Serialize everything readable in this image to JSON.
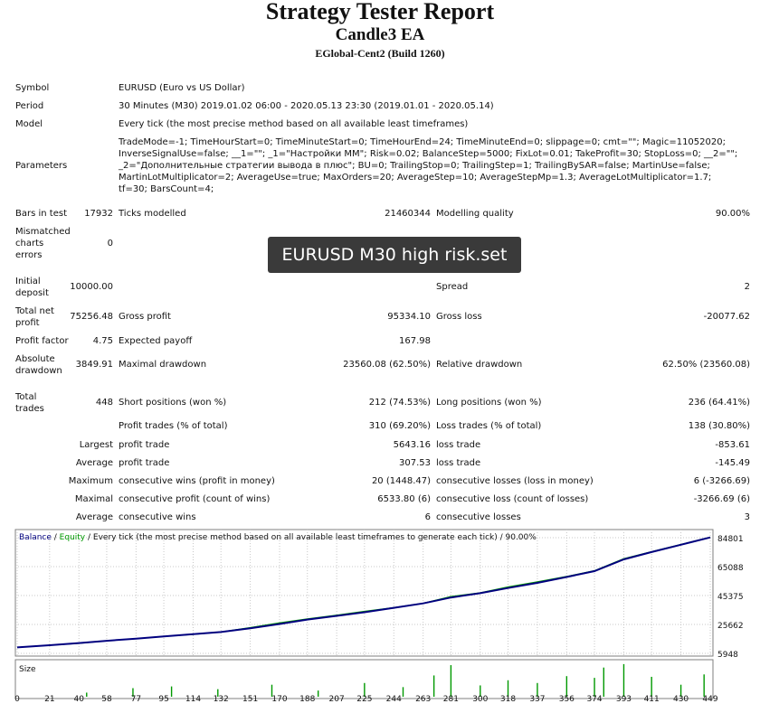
{
  "report": {
    "title": "Strategy Tester Report",
    "ea_name": "Candle3 EA",
    "server": "EGlobal-Cent2 (Build 1260)"
  },
  "settings": {
    "symbol_label": "Symbol",
    "symbol_value": "EURUSD (Euro vs US Dollar)",
    "period_label": "Period",
    "period_value": "30 Minutes (M30) 2019.01.02 06:00 - 2020.05.13 23:30 (2019.01.01 - 2020.05.14)",
    "model_label": "Model",
    "model_value": "Every tick (the most precise method based on all available least timeframes)",
    "parameters_label": "Parameters",
    "parameters_value": "TradeMode=-1; TimeHourStart=0; TimeMinuteStart=0; TimeHourEnd=24; TimeMinuteEnd=0; slippage=0; cmt=\"\"; Magic=11052020; InverseSignalUse=false; __1=\"\"; _1=\"Настройки ММ\"; Risk=0.02; BalanceStep=5000; FixLot=0.01; TakeProfit=30; StopLoss=0; __2=\"\"; _2=\"Дополнительные стратегии вывода в плюс\"; BU=0; TrailingStop=0; TrailingStep=1; TrailingBySAR=false; MartinUse=false; MartinLotMultiplicator=2; AverageUse=true; MaxOrders=20; AverageStep=10; AverageStepMp=1.3; AverageLotMultiplicator=1.7; tf=30; BarsCount=4;"
  },
  "test": {
    "bars_label": "Bars in test",
    "bars_value": "17932",
    "ticks_label": "Ticks modelled",
    "ticks_value": "21460344",
    "quality_label": "Modelling quality",
    "quality_value": "90.00%",
    "mismatch_l1": "Mismatched",
    "mismatch_l2": "charts",
    "mismatch_l3": "errors",
    "mismatch_value": "0"
  },
  "overlay_label": "EURUSD M30 high risk.set",
  "results": {
    "deposit_l1": "Initial",
    "deposit_l2": "deposit",
    "deposit_value": "10000.00",
    "spread_label": "Spread",
    "spread_value": "2",
    "net_l1": "Total net",
    "net_l2": "profit",
    "net_value": "75256.48",
    "gross_profit_label": "Gross profit",
    "gross_profit_value": "95334.10",
    "gross_loss_label": "Gross loss",
    "gross_loss_value": "-20077.62",
    "pf_label": "Profit factor",
    "pf_value": "4.75",
    "ep_label": "Expected payoff",
    "ep_value": "167.98",
    "abs_l1": "Absolute",
    "abs_l2": "drawdown",
    "abs_value": "3849.91",
    "max_dd_label": "Maximal drawdown",
    "max_dd_value": "23560.08 (62.50%)",
    "rel_dd_label": "Relative drawdown",
    "rel_dd_value": "62.50% (23560.08)"
  },
  "trades": {
    "total_l1": "Total",
    "total_l2": "trades",
    "total_value": "448",
    "short_label": "Short positions (won %)",
    "short_value": "212 (74.53%)",
    "long_label": "Long positions (won %)",
    "long_value": "236 (64.41%)",
    "pt_label": "Profit trades (% of total)",
    "pt_value": "310 (69.20%)",
    "lt_label": "Loss trades (% of total)",
    "lt_value": "138 (30.80%)",
    "largest_label": "Largest",
    "lpt_label": "profit trade",
    "lpt_value": "5643.16",
    "llt_label": "loss trade",
    "llt_value": "-853.61",
    "average_label": "Average",
    "apt_label": "profit trade",
    "apt_value": "307.53",
    "alt_label": "loss trade",
    "alt_value": "-145.49",
    "maximum_label": "Maximum",
    "mcw_label": "consecutive wins (profit in money)",
    "mcw_value": "20 (1448.47)",
    "mcl_label": "consecutive losses (loss in money)",
    "mcl_value": "6 (-3266.69)",
    "maximal_label": "Maximal",
    "mcp_label": "consecutive profit (count of wins)",
    "mcp_value": "6533.80 (6)",
    "mcloss_label": "consecutive loss (count of losses)",
    "mcloss_value": "-3266.69 (6)",
    "average2_label": "Average",
    "acw_label": "consecutive wins",
    "acw_value": "6",
    "acl_label": "consecutive losses",
    "acl_value": "3"
  },
  "chart_data": {
    "type": "line",
    "legend": {
      "balance": "Balance",
      "sep1": " / ",
      "equity": "Equity",
      "rest": " / Every tick (the most precise method based on all available least timeframes to generate each tick) / 90.00%"
    },
    "size_label": "Size",
    "colors": {
      "balance": "#00007f",
      "equity": "#009900",
      "size": "#009900",
      "grid": "#c8c8c8"
    },
    "y_ticks": [
      "84801",
      "65088",
      "45375",
      "25662",
      "5948"
    ],
    "ylim": [
      5948,
      84801
    ],
    "x_ticks": [
      "0",
      "21",
      "40",
      "58",
      "77",
      "95",
      "114",
      "132",
      "151",
      "170",
      "188",
      "207",
      "225",
      "244",
      "263",
      "281",
      "300",
      "318",
      "337",
      "356",
      "374",
      "393",
      "411",
      "430",
      "449"
    ],
    "xlim": [
      0,
      449
    ],
    "series": [
      {
        "name": "Balance",
        "x": [
          0,
          21,
          40,
          58,
          77,
          95,
          114,
          132,
          151,
          170,
          188,
          207,
          225,
          244,
          263,
          281,
          300,
          318,
          337,
          356,
          374,
          393,
          411,
          430,
          449
        ],
        "y": [
          10000,
          11500,
          13000,
          14500,
          16000,
          17500,
          19000,
          20500,
          23000,
          26000,
          29000,
          31500,
          34000,
          37000,
          40000,
          44000,
          47000,
          50500,
          54000,
          58000,
          62000,
          70000,
          75000,
          80000,
          85000
        ]
      },
      {
        "name": "Equity",
        "x": [
          0,
          21,
          40,
          58,
          77,
          95,
          114,
          132,
          151,
          170,
          188,
          207,
          225,
          244,
          263,
          281,
          300,
          318,
          337,
          356,
          374,
          393,
          411,
          430,
          449
        ],
        "y": [
          10000,
          11500,
          12800,
          14500,
          15900,
          17500,
          18900,
          20500,
          23500,
          26800,
          29500,
          32000,
          34600,
          37200,
          40100,
          44700,
          47200,
          51200,
          54700,
          58400,
          62300,
          70500,
          75300,
          80200,
          85200
        ]
      }
    ],
    "size_bars": [
      {
        "x": 45,
        "v": 0.12
      },
      {
        "x": 75,
        "v": 0.25
      },
      {
        "x": 100,
        "v": 0.3
      },
      {
        "x": 130,
        "v": 0.22
      },
      {
        "x": 165,
        "v": 0.35
      },
      {
        "x": 195,
        "v": 0.18
      },
      {
        "x": 225,
        "v": 0.4
      },
      {
        "x": 250,
        "v": 0.28
      },
      {
        "x": 270,
        "v": 0.62
      },
      {
        "x": 281,
        "v": 0.92
      },
      {
        "x": 300,
        "v": 0.33
      },
      {
        "x": 318,
        "v": 0.48
      },
      {
        "x": 337,
        "v": 0.4
      },
      {
        "x": 356,
        "v": 0.6
      },
      {
        "x": 374,
        "v": 0.55
      },
      {
        "x": 380,
        "v": 0.85
      },
      {
        "x": 393,
        "v": 0.95
      },
      {
        "x": 411,
        "v": 0.58
      },
      {
        "x": 430,
        "v": 0.35
      },
      {
        "x": 445,
        "v": 0.65
      }
    ]
  }
}
